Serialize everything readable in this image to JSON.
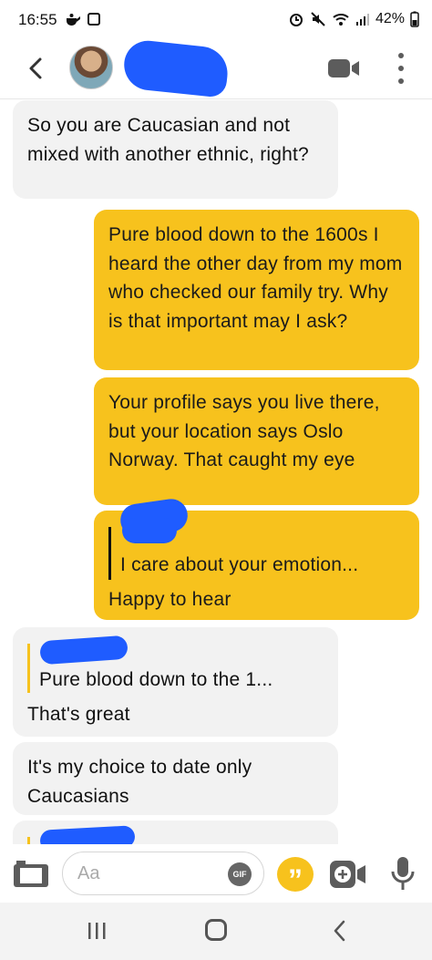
{
  "status_bar": {
    "time": "16:55",
    "battery": "42%"
  },
  "header": {
    "contact_name_redacted": true,
    "icons": [
      "back-arrow-icon",
      "video-call-icon",
      "more-options-icon"
    ]
  },
  "messages": [
    {
      "id": 1,
      "direction": "incoming",
      "text": "So you are Caucasian and not mixed with another ethnic, right?"
    },
    {
      "id": 2,
      "direction": "outgoing",
      "text": "Pure blood down to the 1600s I heard the other day from my mom who checked our family try. Why is that important may I ask?"
    },
    {
      "id": 3,
      "direction": "outgoing",
      "text": "Your profile says you live there, but your location says Oslo Norway. That caught my eye"
    },
    {
      "id": 4,
      "direction": "outgoing",
      "quote": "I care about your emotion...",
      "text": "Happy to hear"
    },
    {
      "id": 5,
      "direction": "incoming",
      "quote": "Pure blood down to the 1...",
      "text": "That's great"
    },
    {
      "id": 6,
      "direction": "incoming",
      "text": "It's my choice to date only Caucasians"
    }
  ],
  "composer": {
    "placeholder": "Aa",
    "gif_label": "GIF",
    "quote_glyph": "”"
  },
  "colors": {
    "outgoing_bubble": "#f7c21d",
    "incoming_bubble": "#f2f2f2",
    "redaction": "#1f5cff"
  }
}
